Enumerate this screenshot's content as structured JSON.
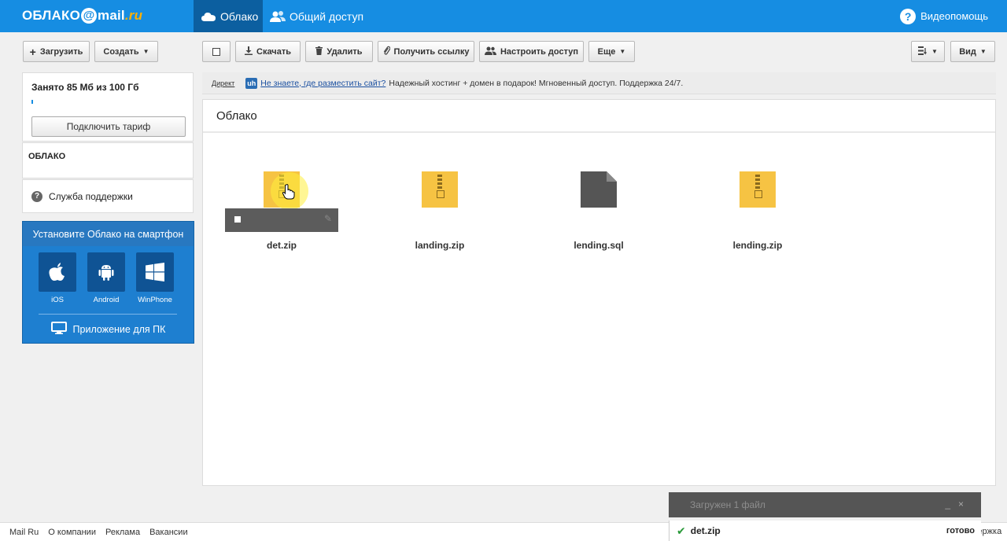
{
  "header": {
    "logo_left": "ОБЛАКО",
    "logo_mail": "mail",
    "logo_ru": ".ru",
    "nav_cloud": "Облако",
    "nav_shared": "Общий доступ",
    "help": "Видеопомощь"
  },
  "toolbar": {
    "upload": "Загрузить",
    "create": "Создать",
    "download": "Скачать",
    "delete": "Удалить",
    "get_link": "Получить ссылку",
    "access": "Настроить доступ",
    "more": "Еще",
    "view": "Вид"
  },
  "sidebar": {
    "quota": "Занято 85 Мб из 100 Гб",
    "quota_used_fraction": 0.00085,
    "tariff": "Подключить тариф",
    "folder": "ОБЛАКО",
    "support": "Служба поддержки",
    "mobile_title": "Установите Облако на смартфон",
    "platforms": [
      "iOS",
      "Android",
      "WinPhone"
    ],
    "pc_app": "Приложение для ПК"
  },
  "ad": {
    "direct": "Директ",
    "badge": "uh",
    "link": "Не знаете, где разместить сайт?",
    "text": "Надежный хостинг + домен в подарок! Мгновенный доступ. Поддержка 24/7."
  },
  "main": {
    "title": "Облако",
    "files": [
      {
        "name": "det.zip",
        "type": "zip"
      },
      {
        "name": "landing.zip",
        "type": "zip"
      },
      {
        "name": "lending.sql",
        "type": "doc"
      },
      {
        "name": "lending.zip",
        "type": "zip"
      }
    ]
  },
  "footer": {
    "links": [
      "Mail Ru",
      "О компании",
      "Реклама",
      "Вакансии"
    ],
    "cut_text": "держка"
  },
  "upload_panel": {
    "title": "Загружен 1 файл",
    "file": "det.zip",
    "status": "готово"
  },
  "colors": {
    "brand": "#168de2",
    "zip": "#f6c343",
    "doc": "#555555"
  }
}
